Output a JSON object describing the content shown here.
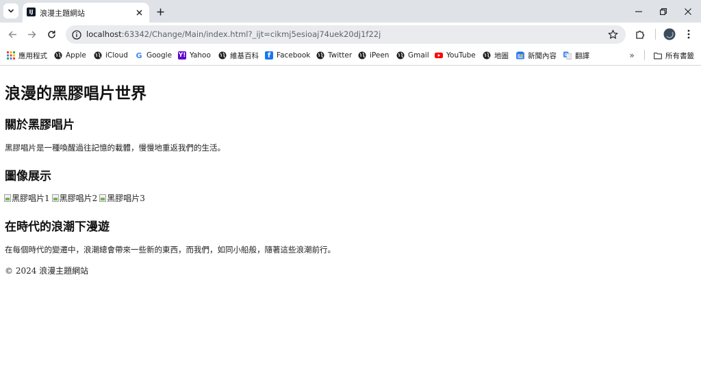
{
  "browser": {
    "tab": {
      "title": "浪漫主題網站",
      "favicon_text": "IJ"
    },
    "address_bar": {
      "host": "localhost",
      "rest": ":63342/Change/Main/index.html?_ijt=cikmj5esioaj74uek20dj1f22j"
    },
    "bookmarks": [
      {
        "label": "應用程式",
        "icon": "apps-grid-icon"
      },
      {
        "label": "Apple",
        "icon": "globe-icon"
      },
      {
        "label": "iCloud",
        "icon": "globe-icon"
      },
      {
        "label": "Google",
        "icon": "google-icon"
      },
      {
        "label": "Yahoo",
        "icon": "yahoo-icon"
      },
      {
        "label": "維基百科",
        "icon": "globe-icon"
      },
      {
        "label": "Facebook",
        "icon": "facebook-icon"
      },
      {
        "label": "Twitter",
        "icon": "globe-icon"
      },
      {
        "label": "iPeen",
        "icon": "globe-icon"
      },
      {
        "label": "Gmail",
        "icon": "globe-icon"
      },
      {
        "label": "YouTube",
        "icon": "youtube-icon"
      },
      {
        "label": "地圖",
        "icon": "globe-icon"
      },
      {
        "label": "新聞內容",
        "icon": "news-icon"
      },
      {
        "label": "翻譯",
        "icon": "translate-icon"
      }
    ],
    "all_bookmarks_label": "所有書籤",
    "more_bookmarks": "»"
  },
  "page": {
    "title": "浪漫的黑膠唱片世界",
    "about_heading": "關於黑膠唱片",
    "about_text": "黑膠唱片是一種喚醒過往記憶的載體，慢慢地重返我們的生活。",
    "gallery_heading": "圖像展示",
    "images": [
      {
        "alt": "黑膠唱片1"
      },
      {
        "alt": "黑膠唱片2"
      },
      {
        "alt": "黑膠唱片3"
      }
    ],
    "wave_heading": "在時代的浪潮下漫遊",
    "wave_text": "在每個時代的變遷中，浪潮總會帶來一些新的東西，而我們，如同小船般，隨著這些浪潮前行。",
    "footer": "© 2024 浪漫主題網站"
  },
  "colors": {
    "tabstrip": "#dfe3e7",
    "omnibox": "#e9ebee",
    "facebook": "#1877f2",
    "youtube": "#ff0000",
    "yahoo": "#6001d2"
  }
}
